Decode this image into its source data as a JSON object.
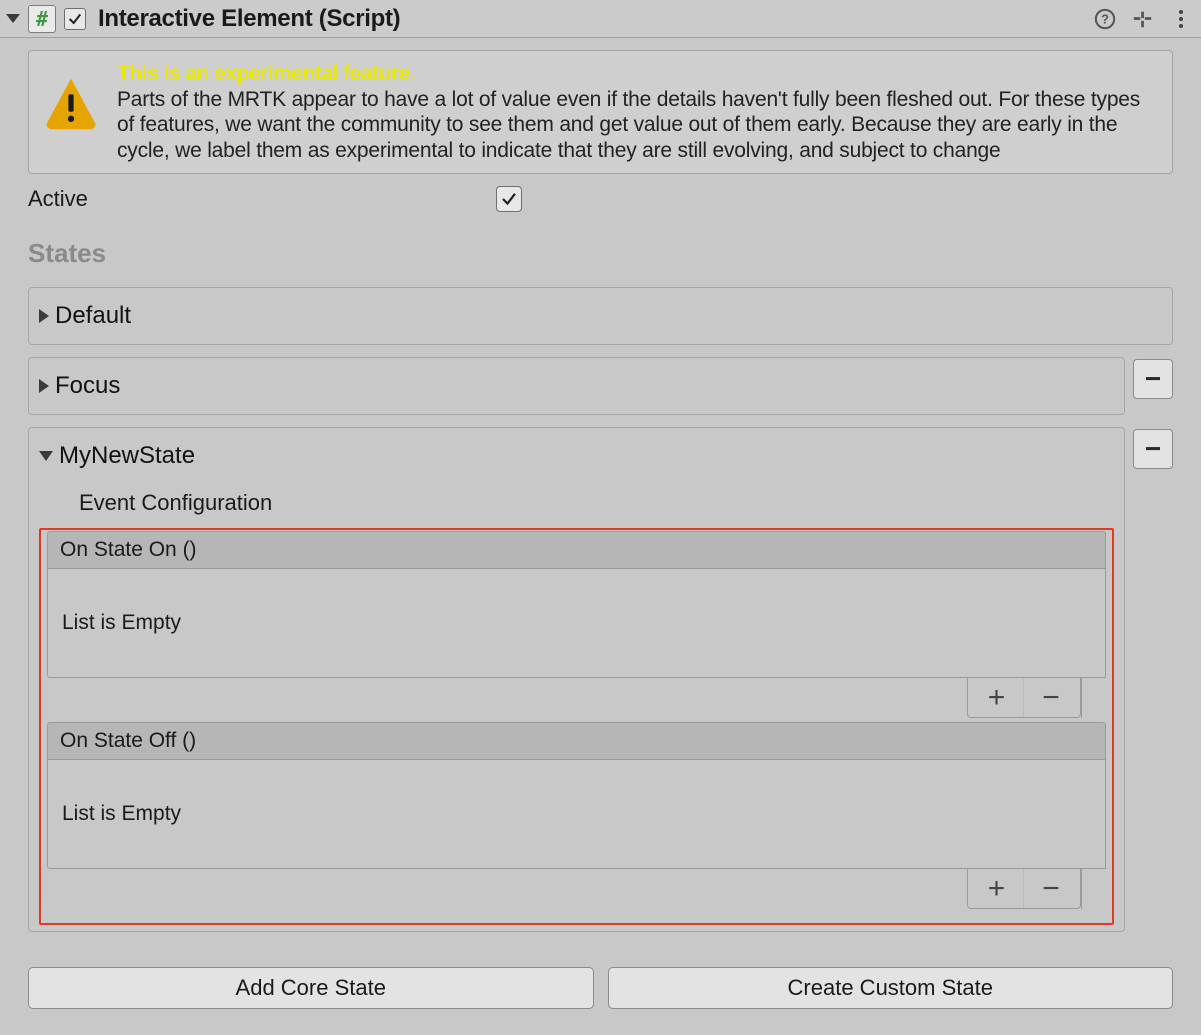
{
  "header": {
    "title": "Interactive Element (Script)",
    "enabled": true
  },
  "experimental": {
    "headline": "This is an experimental feature.",
    "body": "Parts of the MRTK appear to have a lot of value even if the details haven't fully been fleshed out. For these types of features, we want the community to see them and get value out of them early. Because they are early in the cycle, we label them as experimental to indicate that they are still evolving, and subject to change"
  },
  "active": {
    "label": "Active",
    "value": true
  },
  "states_header": "States",
  "states": {
    "default": {
      "label": "Default"
    },
    "focus": {
      "label": "Focus"
    },
    "custom": {
      "label": "MyNewState",
      "event_config_label": "Event Configuration",
      "on_state_on": {
        "title": "On State On ()",
        "empty_text": "List is Empty"
      },
      "on_state_off": {
        "title": "On State Off ()",
        "empty_text": "List is Empty"
      }
    }
  },
  "buttons": {
    "add_core": "Add Core State",
    "create_custom": "Create Custom State"
  },
  "glyphs": {
    "plus": "+",
    "minus": "−",
    "hash": "#"
  }
}
